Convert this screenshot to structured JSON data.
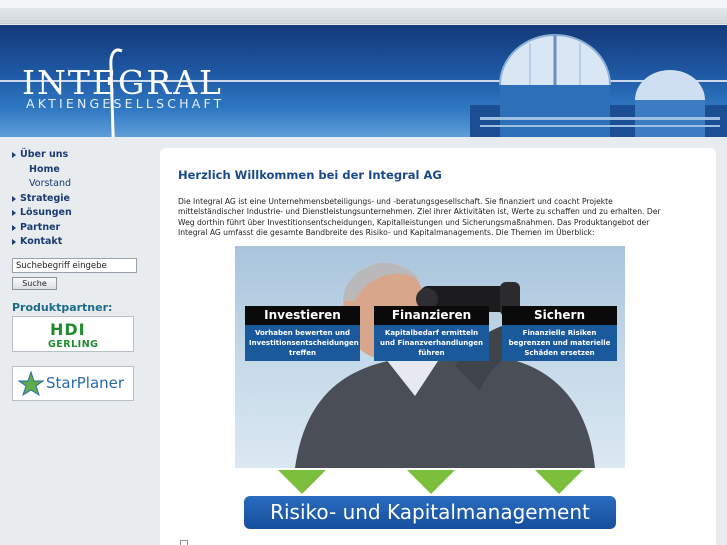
{
  "header": {
    "logo_main": "INTEGRAL",
    "logo_sub": "AKTIENGESELLSCHAFT"
  },
  "nav": {
    "items": [
      {
        "label": "Über uns"
      },
      {
        "label": "Home"
      },
      {
        "label": "Vorstand"
      },
      {
        "label": "Strategie"
      },
      {
        "label": "Lösungen"
      },
      {
        "label": "Partner"
      },
      {
        "label": "Kontakt"
      }
    ]
  },
  "search": {
    "value": "Suchebegriff eingebe",
    "button_label": "Suche"
  },
  "partners": {
    "title": "Produktpartner:",
    "hdi_top": "HDI",
    "hdi_bottom": "GERLING",
    "starplaner": "StarPlaner"
  },
  "main": {
    "title": "Herzlich Willkommen bei der Integral AG",
    "intro": "Die Integral AG ist eine Unternehmensbeteiligungs- und -beratungsgesellschaft. Sie finanziert und coacht Projekte mittelständischer Industrie- und Dienstleistungsunternehmen. Ziel ihrer Aktivitäten ist, Werte zu schaffen und zu erhalten. Der Weg dorthin führt über Investitionsentscheidungen, Kapitalleistungen und Sicherungsmaßnahmen. Das Produktangebot der Integral AG umfasst die gesamte Bandbreite des Risiko- und Kapitalmanagements. Die Themen im Überblick:",
    "tiles": [
      {
        "title": "Investieren",
        "text": "Vorhaben bewerten und Investitionsentscheidungen treffen"
      },
      {
        "title": "Finanzieren",
        "text": "Kapitalbedarf ermitteln und Finanzverhandlungen führen"
      },
      {
        "title": "Sichern",
        "text": "Finanzielle Risiken begrenzen und materielle Schäden ersetzen"
      }
    ],
    "banner": "Risiko- und Kapitalmanagement"
  },
  "colors": {
    "header_blue": "#1f5aa6",
    "nav_text": "#1a3b70",
    "title_blue": "#1a4a8a",
    "arrow_green": "#7cbf3c"
  }
}
